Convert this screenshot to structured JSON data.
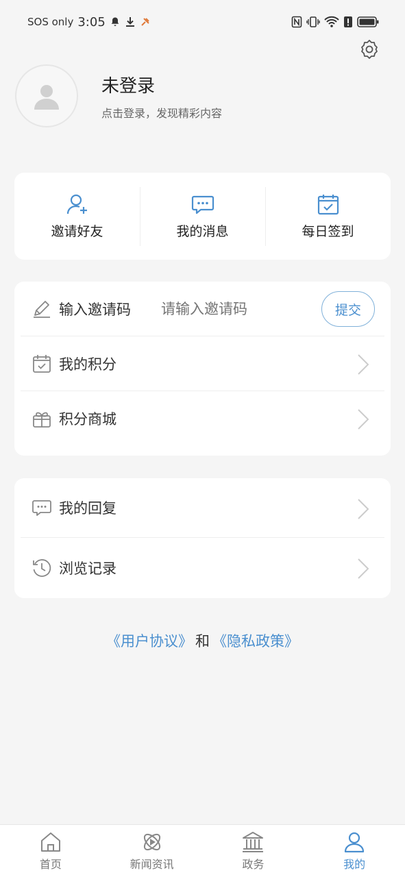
{
  "status_bar": {
    "carrier": "SOS only",
    "time": "3:05"
  },
  "profile": {
    "name": "未登录",
    "subtitle": "点击登录，发现精彩内容"
  },
  "quick_actions": [
    {
      "label": "邀请好友",
      "icon": "add-user-icon"
    },
    {
      "label": "我的消息",
      "icon": "message-icon"
    },
    {
      "label": "每日签到",
      "icon": "calendar-check-icon"
    }
  ],
  "invite": {
    "label": "输入邀请码",
    "placeholder": "请输入邀请码",
    "submit": "提交"
  },
  "list_a": [
    {
      "label": "我的积分",
      "icon": "points-icon"
    },
    {
      "label": "积分商城",
      "icon": "gift-icon"
    }
  ],
  "list_b": [
    {
      "label": "我的回复",
      "icon": "reply-icon"
    },
    {
      "label": "浏览记录",
      "icon": "history-icon"
    }
  ],
  "agreement": {
    "user_agreement": "《用户协议》",
    "and": "和",
    "privacy_policy": "《隐私政策》"
  },
  "tabs": [
    {
      "label": "首页",
      "icon": "home-icon"
    },
    {
      "label": "新闻资讯",
      "icon": "news-icon"
    },
    {
      "label": "政务",
      "icon": "government-icon"
    },
    {
      "label": "我的",
      "icon": "user-icon",
      "active": true
    }
  ],
  "colors": {
    "accent": "#4a8fcf",
    "background": "#f5f5f5"
  }
}
